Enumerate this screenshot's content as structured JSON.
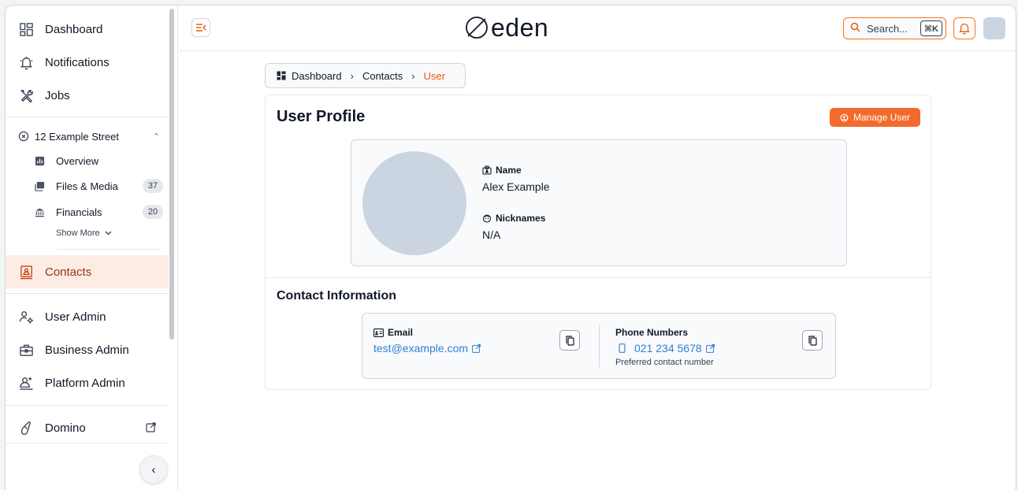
{
  "app": {
    "logo_text": "eden"
  },
  "sidebar": {
    "main_items": [
      {
        "label": "Dashboard",
        "icon": "dashboard-icon"
      },
      {
        "label": "Notifications",
        "icon": "bell-icon"
      },
      {
        "label": "Jobs",
        "icon": "tools-icon"
      }
    ],
    "property": {
      "label": "12 Example Street",
      "items": [
        {
          "label": "Overview",
          "icon": "chart-icon",
          "count": ""
        },
        {
          "label": "Files & Media",
          "icon": "gallery-icon",
          "count": "37"
        },
        {
          "label": "Financials",
          "icon": "bank-icon",
          "count": "20"
        }
      ],
      "show_more": "Show More"
    },
    "contacts": {
      "label": "Contacts",
      "icon": "contacts-icon",
      "active": true
    },
    "admin_items": [
      {
        "label": "User Admin",
        "icon": "user-gear-icon"
      },
      {
        "label": "Business Admin",
        "icon": "briefcase-icon"
      },
      {
        "label": "Platform Admin",
        "icon": "platform-admin-icon"
      }
    ],
    "external": {
      "label": "Domino",
      "icon": "domino-icon"
    }
  },
  "topbar": {
    "search_placeholder": "Search...",
    "search_shortcut": "⌘K"
  },
  "breadcrumb": [
    "Dashboard",
    "Contacts",
    "User"
  ],
  "profile": {
    "title": "User Profile",
    "manage_button": "Manage User",
    "name_label": "Name",
    "name_value": "Alex Example",
    "nicknames_label": "Nicknames",
    "nicknames_value": "N/A"
  },
  "contact_info": {
    "title": "Contact Information",
    "email_label": "Email",
    "email_value": "test@example.com",
    "phone_label": "Phone Numbers",
    "phone_value": "021 234 5678",
    "phone_hint": "Preferred contact number"
  },
  "colors": {
    "accent": "#f26b2c",
    "active_bg": "#fdece4",
    "link": "#2f7fd6",
    "avatar_placeholder": "#cbd5e1"
  }
}
